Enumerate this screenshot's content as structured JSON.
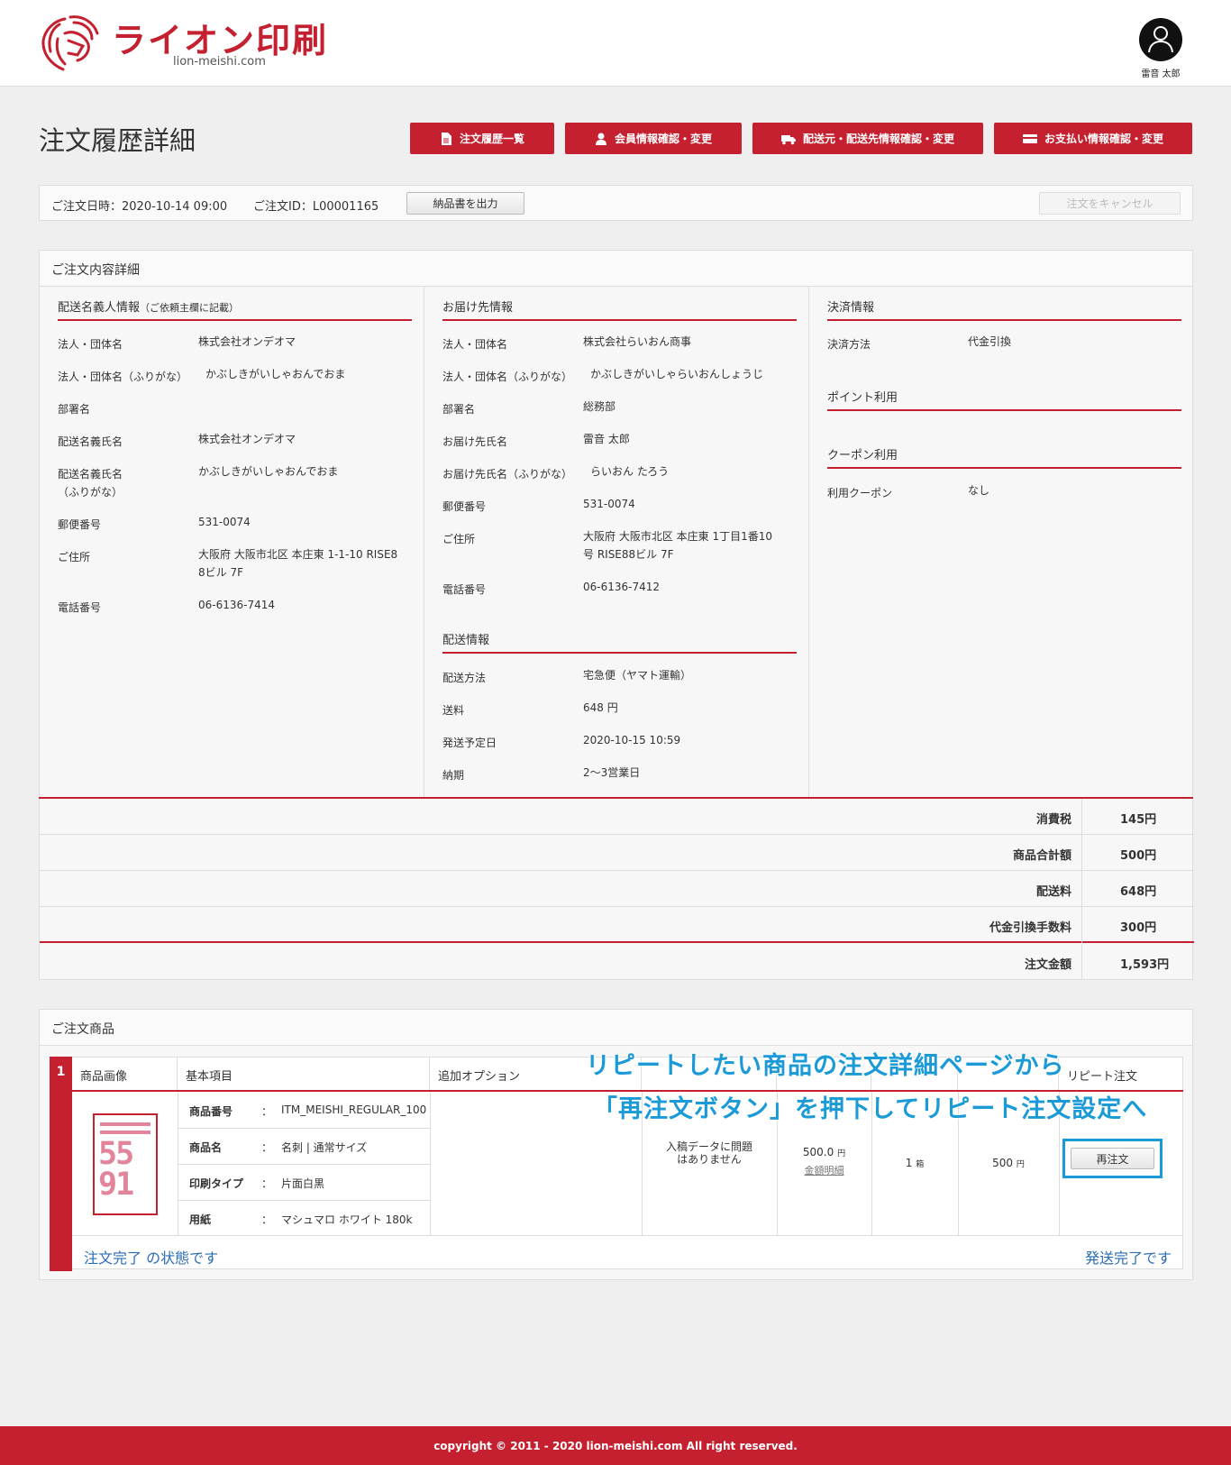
{
  "header": {
    "logo_text": "ライオン印刷",
    "logo_sub": "lion-meishi.com",
    "user_name": "雷音 太郎"
  },
  "page_title": "注文履歴詳細",
  "nav": [
    {
      "label": "注文履歴一覧",
      "icon": "document-icon"
    },
    {
      "label": "会員情報確認・変更",
      "icon": "user-icon"
    },
    {
      "label": "配送元・配送先情報確認・変更",
      "icon": "truck-icon"
    },
    {
      "label": "お支払い情報確認・変更",
      "icon": "credit-card-icon"
    }
  ],
  "order_info": {
    "date": "ご注文日時：2020-10-14 09:00",
    "id": "ご注文ID：L00001165",
    "invoice_btn": "納品書を出力",
    "cancel_btn": "注文をキャンセル"
  },
  "detail": {
    "title": "ご注文内容詳細",
    "sender": {
      "title": "配送名義人情報",
      "title_note": "（ご依頼主欄に記載）",
      "rows": [
        {
          "label": "法人・団体名",
          "value": "株式会社オンデオマ"
        },
        {
          "label": "法人・団体名（ふりがな）",
          "value": "かぶしきがいしゃおんでおま"
        },
        {
          "label": "部署名",
          "value": ""
        },
        {
          "label": "配送名義氏名",
          "value": "株式会社オンデオマ"
        },
        {
          "label": "配送名義氏名",
          "label2": "（ふりがな）",
          "value": "かぶしきがいしゃおんでおま"
        },
        {
          "label": "郵便番号",
          "value": "531-0074"
        },
        {
          "label": "ご住所",
          "value": "大阪府 大阪市北区 本庄東 1-1-10 RISE8",
          "value2": "8ビル 7F"
        },
        {
          "label": "電話番号",
          "value": "06-6136-7414"
        }
      ]
    },
    "delivery": {
      "title": "お届け先情報",
      "rows": [
        {
          "label": "法人・団体名",
          "value": "株式会社らいおん商事"
        },
        {
          "label": "法人・団体名（ふりがな）",
          "value": "かぶしきがいしゃらいおんしょうじ"
        },
        {
          "label": "部署名",
          "value": "総務部"
        },
        {
          "label": "お届け先氏名",
          "value": "雷音 太郎"
        },
        {
          "label": "お届け先氏名（ふりがな）",
          "value": "らいおん たろう"
        },
        {
          "label": "郵便番号",
          "value": "531-0074"
        },
        {
          "label": "ご住所",
          "value": "大阪府 大阪市北区 本庄東 1丁目1番10",
          "value2": "号 RISE88ビル 7F"
        },
        {
          "label": "電話番号",
          "value": "06-6136-7412"
        }
      ]
    },
    "shipping": {
      "title": "配送情報",
      "rows": [
        {
          "label": "配送方法",
          "value": "宅急便（ヤマト運輸）"
        },
        {
          "label": "送料",
          "value": "648 円"
        },
        {
          "label": "発送予定日",
          "value": "2020-10-15 10:59"
        },
        {
          "label": "納期",
          "value": "2〜3営業日"
        }
      ]
    },
    "payment": {
      "title": "決済情報",
      "method_label": "決済方法",
      "method_value": "代金引換",
      "points_title": "ポイント利用",
      "coupon_title": "クーポン利用",
      "coupon_label": "利用クーポン",
      "coupon_value": "なし"
    }
  },
  "summary": [
    {
      "label": "消費税",
      "value": "145円"
    },
    {
      "label": "商品合計額",
      "value": "500円"
    },
    {
      "label": "配送料",
      "value": "648円"
    },
    {
      "label": "代金引換手数料",
      "value": "300円"
    },
    {
      "label": "注文金額",
      "value": "1,593円"
    }
  ],
  "products": {
    "title": "ご注文商品",
    "index": "1",
    "headers": {
      "image": "商品画像",
      "basic": "基本項目",
      "options": "追加オプション",
      "repeat": "リピート注文"
    },
    "props": [
      {
        "label": "商品番号",
        "value": "ITM_MEISHI_REGULAR_100"
      },
      {
        "label": "商品名",
        "value": "名刺 | 通常サイズ"
      },
      {
        "label": "印刷タイプ",
        "value": "片面白黒"
      },
      {
        "label": "用紙",
        "value": "マシュマロ ホワイト 180k"
      }
    ],
    "prop_sep": "：",
    "thumb": {
      "line1": "55",
      "line2": "91"
    },
    "data_status": "入稿データに問題はありません",
    "unit_price": "500.0",
    "unit_price_unit": "円",
    "price_detail_link": "金額明細",
    "qty": "1",
    "qty_unit": "箱",
    "subtotal": "500",
    "subtotal_unit": "円",
    "reorder_btn": "再注文",
    "status_text": "注文完了 の状態です",
    "ship_status": "発送完了です"
  },
  "overlay": {
    "line1": "リピートしたい商品の注文詳細ページから",
    "line2": "「再注文ボタン」を押下してリピート注文設定へ"
  },
  "footer": "copyright © 2011 - 2020 lion-meishi.com All right reserved.",
  "colors": {
    "brand": "#c4202f",
    "highlight": "#1a9ad6",
    "link": "#2a6db4"
  }
}
